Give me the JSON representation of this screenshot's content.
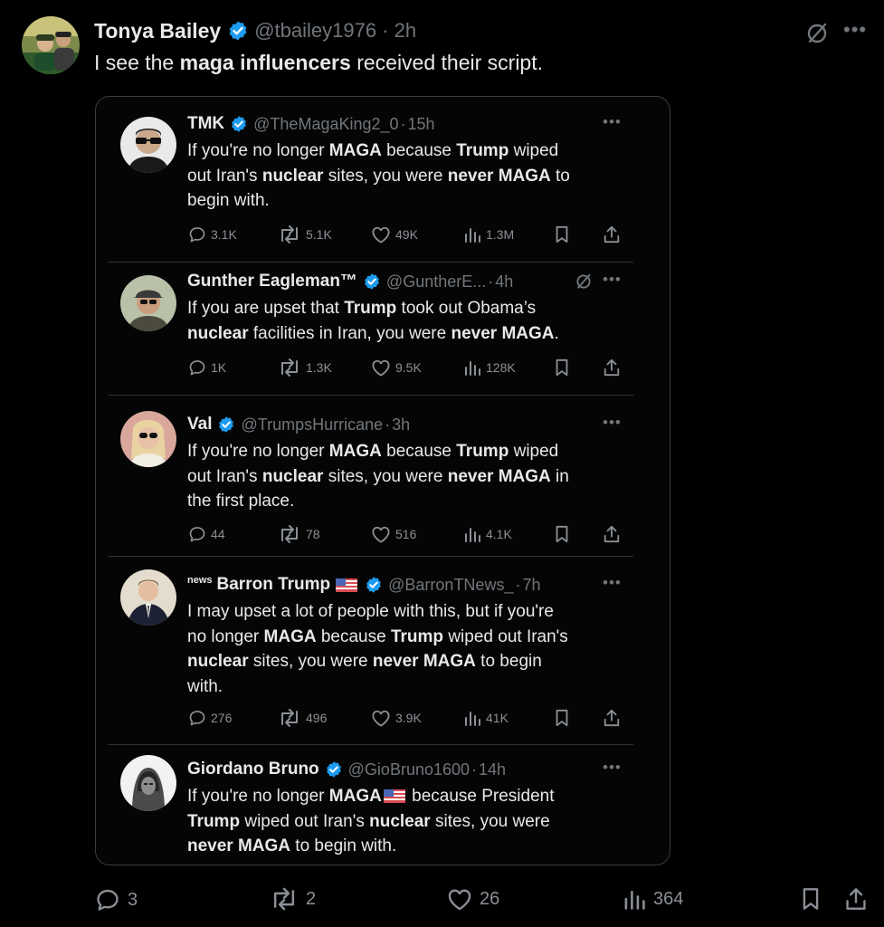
{
  "post": {
    "author_name": "Tonya Bailey",
    "author_handle": "@tbailey1976",
    "time": "2h",
    "text_parts": [
      "I see the ",
      "maga influencers",
      " received their script."
    ],
    "stats": {
      "replies": "3",
      "reposts": "2",
      "likes": "26",
      "views": "364"
    }
  },
  "colors": {
    "verified_blue": "#1d9bf0",
    "muted": "#71767b",
    "background": "#000000"
  },
  "tweets": [
    {
      "name": "TMK",
      "handle": "@TheMagaKing2_0",
      "time": "15h",
      "lines": [
        [
          [
            "If you're no longer ",
            false
          ],
          [
            "MAGA",
            true
          ],
          [
            " because ",
            false
          ],
          [
            "Trump",
            true
          ],
          [
            " wiped",
            false
          ]
        ],
        [
          [
            "out Iran's ",
            false
          ],
          [
            "nuclear",
            true
          ],
          [
            " sites, you were ",
            false
          ],
          [
            "never MAGA",
            true
          ],
          [
            " to",
            false
          ]
        ],
        [
          [
            "begin with.",
            false
          ]
        ]
      ],
      "stats": {
        "replies": "3.1K",
        "reposts": "5.1K",
        "likes": "49K",
        "views": "1.3M"
      }
    },
    {
      "name": "Gunther Eagleman™",
      "handle": "@GuntherE...",
      "time": "4h",
      "lines": [
        [
          [
            "If you are upset that ",
            false
          ],
          [
            "Trump",
            true
          ],
          [
            " took out Obama’s",
            false
          ]
        ],
        [
          [
            "nuclear",
            true
          ],
          [
            " facilities in Iran, you were ",
            false
          ],
          [
            "never MAGA",
            true
          ],
          [
            ".",
            false
          ]
        ]
      ],
      "stats": {
        "replies": "1K",
        "reposts": "1.3K",
        "likes": "9.5K",
        "views": "128K"
      }
    },
    {
      "name": "Val",
      "handle": "@TrumpsHurricane",
      "time": "3h",
      "lines": [
        [
          [
            "If you're no longer ",
            false
          ],
          [
            "MAGA",
            true
          ],
          [
            " because ",
            false
          ],
          [
            "Trump",
            true
          ],
          [
            " wiped",
            false
          ]
        ],
        [
          [
            "out Iran's ",
            false
          ],
          [
            "nuclear",
            true
          ],
          [
            " sites, you were ",
            false
          ],
          [
            "never MAGA",
            true
          ],
          [
            " in",
            false
          ]
        ],
        [
          [
            "the first place.",
            false
          ]
        ]
      ],
      "stats": {
        "replies": "44",
        "reposts": "78",
        "likes": "516",
        "views": "4.1K"
      }
    },
    {
      "news_tag": "news",
      "name": "Barron Trump",
      "handle": "@BarronTNews_",
      "time": "7h",
      "lines": [
        [
          [
            "I may upset a lot of people with this, but if you're",
            false
          ]
        ],
        [
          [
            "no longer ",
            false
          ],
          [
            "MAGA",
            true
          ],
          [
            " because ",
            false
          ],
          [
            "Trump",
            true
          ],
          [
            " wiped out Iran's",
            false
          ]
        ],
        [
          [
            "nuclear",
            true
          ],
          [
            " sites, you were ",
            false
          ],
          [
            "never MAGA",
            true
          ],
          [
            " to begin",
            false
          ]
        ],
        [
          [
            "with.",
            false
          ]
        ]
      ],
      "stats": {
        "replies": "276",
        "reposts": "496",
        "likes": "3.9K",
        "views": "41K"
      }
    },
    {
      "name": "Giordano Bruno",
      "handle": "@GioBruno1600",
      "time": "14h",
      "lines": [
        [
          [
            "If you're no longer ",
            false
          ],
          [
            "MAGA",
            true
          ],
          [
            "FLAG",
            false
          ],
          [
            " because President",
            false
          ]
        ],
        [
          [
            "Trump",
            true
          ],
          [
            " wiped out Iran's ",
            false
          ],
          [
            "nuclear",
            true
          ],
          [
            " sites, you were",
            false
          ]
        ],
        [
          [
            "never MAGA",
            true
          ],
          [
            " to begin with.",
            false
          ]
        ]
      ]
    }
  ]
}
